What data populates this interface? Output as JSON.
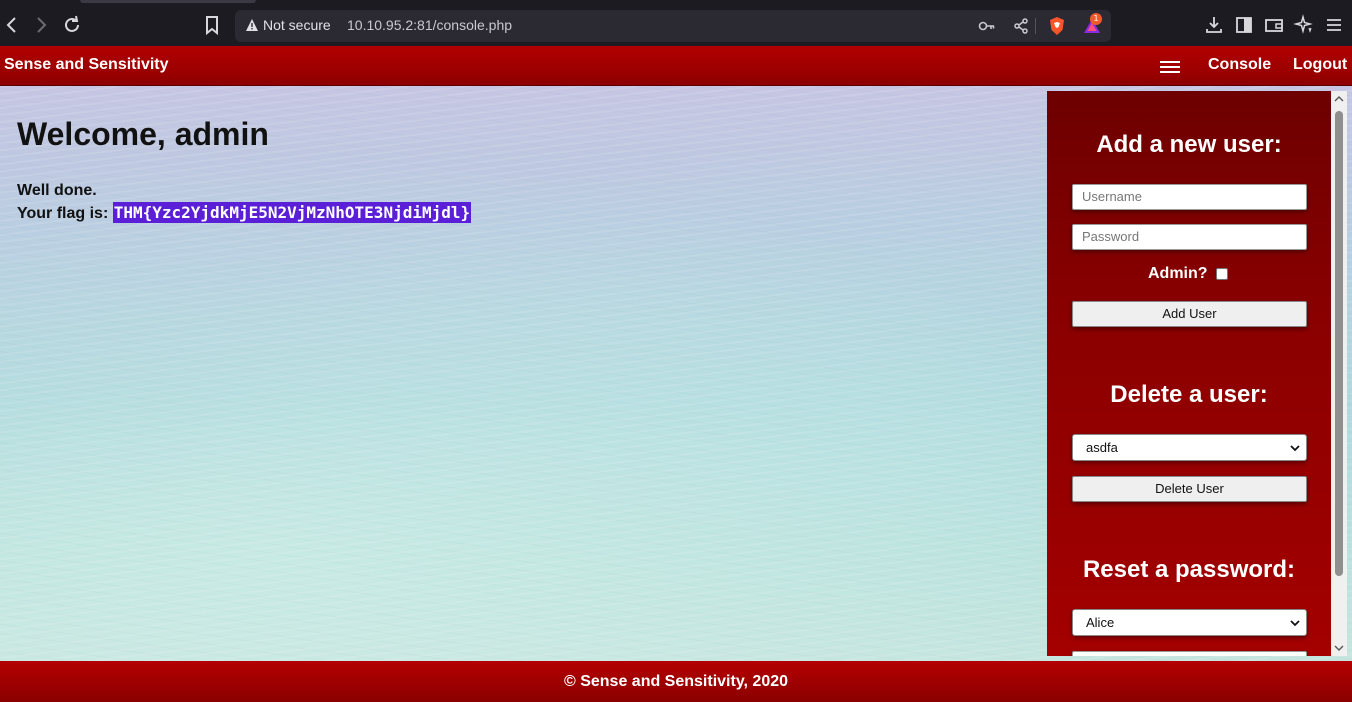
{
  "browser": {
    "security_label": "Not secure",
    "url": "10.10.95.2:81/console.php",
    "extension_badge": "1"
  },
  "header": {
    "brand": "Sense and Sensitivity",
    "nav": {
      "console": "Console",
      "logout": "Logout"
    }
  },
  "main": {
    "welcome": "Welcome, admin",
    "message": "Well done.",
    "flag_label": "Your flag is: ",
    "flag_value": "THM{Yzc2YjdkMjE5N2VjMzNhOTE3NjdiMjdl}"
  },
  "panel": {
    "add": {
      "title": "Add a new user:",
      "username_placeholder": "Username",
      "password_placeholder": "Password",
      "admin_label": "Admin?",
      "button": "Add User"
    },
    "delete": {
      "title": "Delete a user:",
      "selected": "asdfa",
      "button": "Delete User"
    },
    "reset": {
      "title": "Reset a password:",
      "selected": "Alice"
    }
  },
  "footer": {
    "text": "© Sense and Sensitivity, 2020"
  },
  "colors": {
    "brand_red": "#a00000",
    "flag_highlight": "#5b1fd8"
  }
}
